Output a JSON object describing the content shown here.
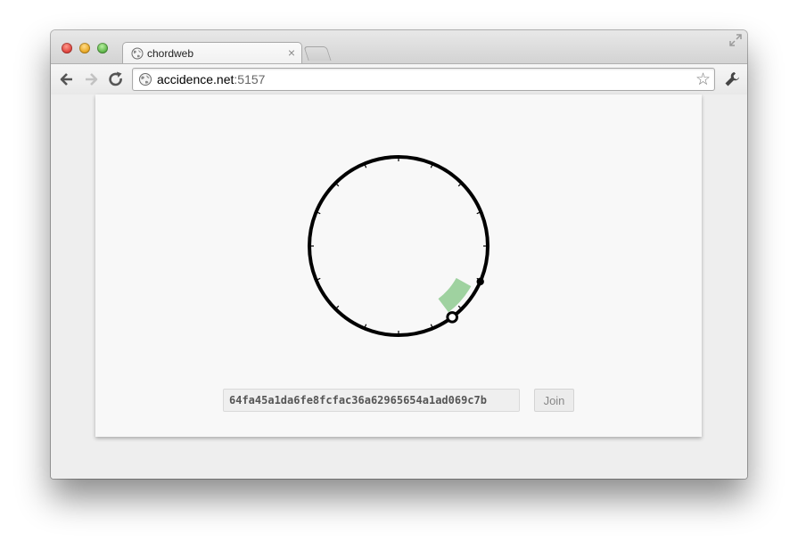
{
  "window": {
    "tab": {
      "title": "chordweb",
      "favicon": "globe-icon"
    },
    "controls": [
      "close",
      "minimize",
      "maximize"
    ]
  },
  "toolbar": {
    "url_host": "accidence.net",
    "url_port": ":5157",
    "icons": [
      "back-icon",
      "forward-icon",
      "reload-icon",
      "star-icon",
      "wrench-icon"
    ]
  },
  "ring": {
    "tick_count": 16,
    "colors": {
      "ring": "#000000",
      "arc": "#9fd2a0"
    },
    "nodes": [
      {
        "kind": "self",
        "style": "hollow"
      },
      {
        "kind": "peer",
        "style": "filled"
      }
    ]
  },
  "form": {
    "node_id_value": "64fa45a1da6fe8fcfac36a62965654a1ad069c7b",
    "join_label": "Join"
  }
}
